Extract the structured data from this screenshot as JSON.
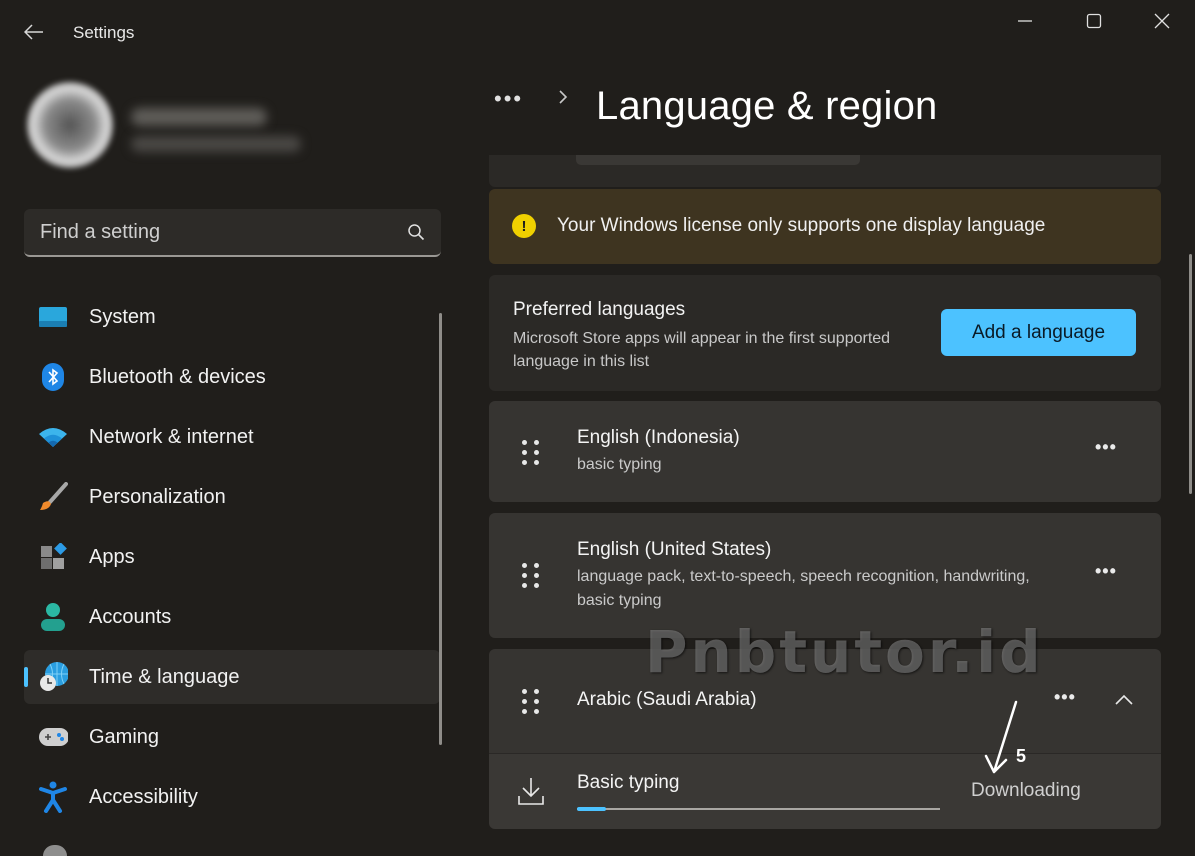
{
  "window": {
    "app_title": "Settings",
    "icons": {
      "back": "back-arrow-icon",
      "minimize": "minimize-icon",
      "maximize": "maximize-icon",
      "close": "close-icon"
    }
  },
  "profile": {
    "name": "[blurred]",
    "email": "[blurred]"
  },
  "search": {
    "placeholder": "Find a setting",
    "value": "",
    "icon": "search-icon"
  },
  "sidebar": {
    "items": [
      {
        "label": "System",
        "icon": "system-display-icon",
        "active": false
      },
      {
        "label": "Bluetooth & devices",
        "icon": "bluetooth-icon",
        "active": false
      },
      {
        "label": "Network & internet",
        "icon": "wifi-icon",
        "active": false
      },
      {
        "label": "Personalization",
        "icon": "paintbrush-icon",
        "active": false
      },
      {
        "label": "Apps",
        "icon": "apps-icon",
        "active": false
      },
      {
        "label": "Accounts",
        "icon": "person-icon",
        "active": false
      },
      {
        "label": "Time & language",
        "icon": "globe-clock-icon",
        "active": true
      },
      {
        "label": "Gaming",
        "icon": "gamepad-icon",
        "active": false
      },
      {
        "label": "Accessibility",
        "icon": "accessibility-icon",
        "active": false
      }
    ]
  },
  "header": {
    "breadcrumb_more": "•••",
    "title": "Language & region"
  },
  "warning": {
    "text": "Your Windows license only supports one display language",
    "icon": "warning-icon"
  },
  "preferred": {
    "title": "Preferred languages",
    "description": "Microsoft Store apps will appear in the first supported language in this list",
    "add_button": "Add a language"
  },
  "languages": [
    {
      "name": "English (Indonesia)",
      "features": "basic typing",
      "more": "•••"
    },
    {
      "name": "English (United States)",
      "features": "language pack, text-to-speech, speech recognition, handwriting, basic typing",
      "more": "•••"
    },
    {
      "name": "Arabic (Saudi Arabia)",
      "features": "",
      "more": "•••",
      "expanded": true
    }
  ],
  "download": {
    "feature": "Basic typing",
    "status": "Downloading",
    "progress_percent": 8
  },
  "overlay": {
    "watermark": "Pnbtutor.id",
    "annotation_number": "5"
  },
  "colors": {
    "accent": "#4cc2ff",
    "warning_bg": "#3e3420",
    "warning_icon": "#f0d000",
    "background": "#201e1b"
  }
}
